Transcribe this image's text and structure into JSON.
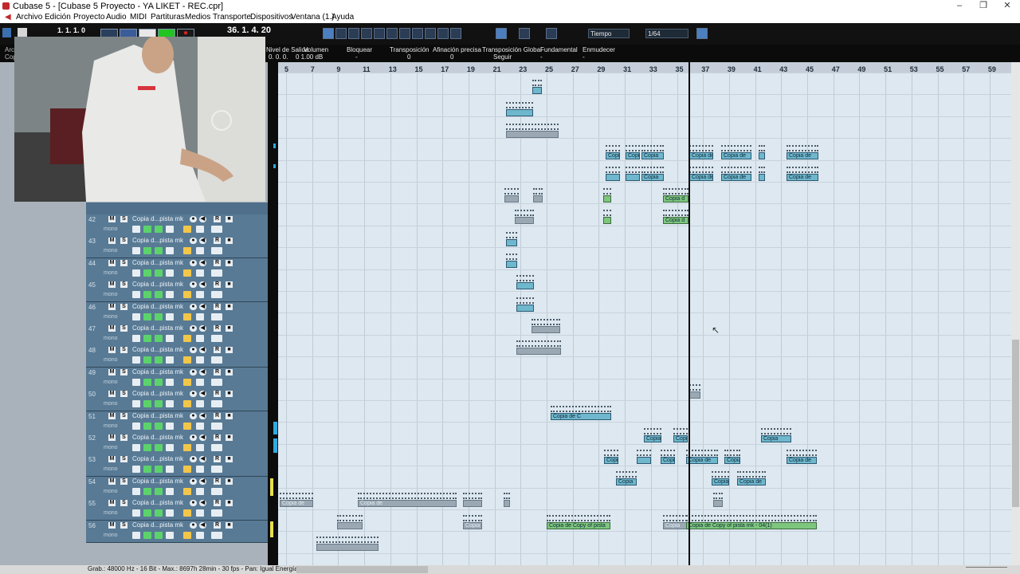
{
  "window": {
    "title": "Cubase 5 - [Cubase 5 Proyecto - YA LIKET - REC.cpr]"
  },
  "menu": [
    "Archivo",
    "Edición",
    "Proyecto",
    "Audio",
    "MIDI",
    "Partituras",
    "Medios",
    "Transporte",
    "Dispositivos",
    "Ventana (1.)",
    "Ayuda"
  ],
  "toolbar": {
    "position_left": "1. 1. 1.  0",
    "position_right": "36. 1. 4. 20",
    "snap_label": "Tiempo",
    "quantize_label": "1/64"
  },
  "infoline": {
    "labels": [
      "Nivel de Salida",
      "Volumen",
      "Bloquear",
      "Transposición",
      "Afinación precisa",
      "Transposición Global",
      "Fundamental",
      "Enmudecer"
    ],
    "values": [
      "0. 0. 0.",
      "0  1.00 dB",
      "-",
      "0",
      "0",
      "Seguir",
      "-",
      "-"
    ],
    "left_stub_1": "Arc",
    "left_stub_2": "Cop"
  },
  "ruler": {
    "bars": [
      "5",
      "7",
      "9",
      "11",
      "13",
      "15",
      "17",
      "19",
      "21",
      "23",
      "25",
      "27",
      "29",
      "31",
      "33",
      "35",
      "37",
      "39",
      "41",
      "43",
      "45",
      "47",
      "49",
      "51",
      "53",
      "55",
      "57",
      "59"
    ]
  },
  "tracks": [
    {
      "num": "42",
      "name": "Copia d...pista mk",
      "mono": "mono"
    },
    {
      "num": "43",
      "name": "Copia d...pista mk",
      "mono": "mono"
    },
    {
      "num": "44",
      "name": "Copia d...pista mk",
      "mono": "mono"
    },
    {
      "num": "45",
      "name": "Copia d...pista mk",
      "mono": "mono"
    },
    {
      "num": "46",
      "name": "Copia d...pista mk",
      "mono": "mono"
    },
    {
      "num": "47",
      "name": "Copia d...pista mk",
      "mono": "mono"
    },
    {
      "num": "48",
      "name": "Copia d...pista mk",
      "mono": "mono"
    },
    {
      "num": "49",
      "name": "Copia d...pista mk",
      "mono": "mono"
    },
    {
      "num": "50",
      "name": "Copia d...pista mk",
      "mono": "mono"
    },
    {
      "num": "51",
      "name": "Copia d...pista mk",
      "mono": "mono"
    },
    {
      "num": "52",
      "name": "Copia d...pista mk",
      "mono": "mono"
    },
    {
      "num": "53",
      "name": "Copia d...pista mk",
      "mono": "mono"
    },
    {
      "num": "54",
      "name": "Copia d...pista mk",
      "mono": "mono"
    },
    {
      "num": "55",
      "name": "Copia d...pista mk",
      "mono": "mono"
    },
    {
      "num": "56",
      "name": "Copia d...pista mk",
      "mono": "mono"
    }
  ],
  "clip_labels": {
    "copia": "Copia",
    "copia_de": "Copia de",
    "copia_de_c": "Copia de C",
    "copia_d": "Copia d",
    "copia_de_copy": "Copia de Copy of pista",
    "copia_de_copy_long": "Copia de Copy of pista mk - 04(1)"
  },
  "colors": {
    "accent_clip": "#6fb7cc",
    "green_clip": "#7ec67e",
    "lane_bg": "#dde8f0",
    "cursor": "#0d0d0d"
  },
  "status": {
    "text": "Grab.: 48000 Hz - 16 Bit - Max.: 8697h 28min - 30 fps - Pan: Igual Energía"
  }
}
